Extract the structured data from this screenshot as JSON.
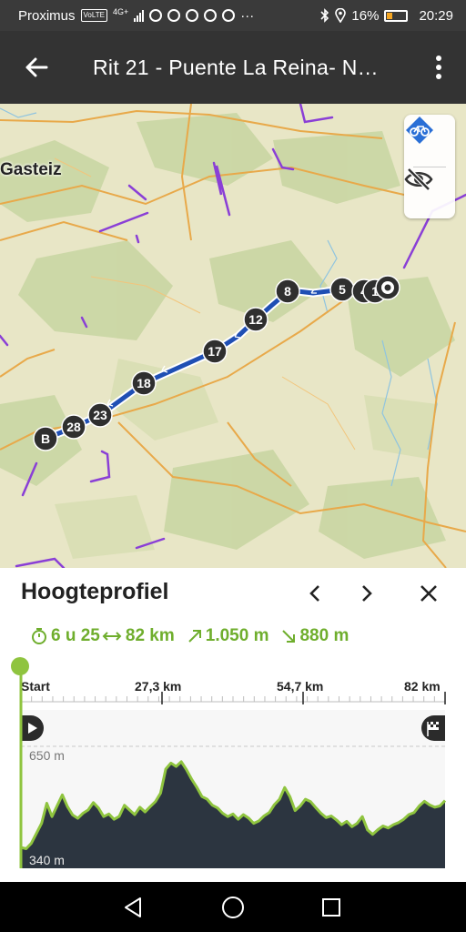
{
  "status_bar": {
    "carrier": "Proximus",
    "volte": "VoLTE",
    "network": "4G+",
    "more": "···",
    "battery": "16%",
    "time": "20:29"
  },
  "app_bar": {
    "title": "Rit 21 - Puente La Reina- N…"
  },
  "map": {
    "place_label": "Gasteiz",
    "waypoints": [
      "B",
      "28",
      "23",
      "18",
      "17",
      "12",
      "8",
      "5",
      "4",
      "1"
    ],
    "route_color": "#1f4fb4",
    "marker_color": "#2f2f2f"
  },
  "panel": {
    "title": "Hoogteprofiel",
    "stats": {
      "duration": "6 u 25",
      "distance": "82 km",
      "ascent": "1.050 m",
      "descent": "880 m"
    },
    "accent_color": "#6fae2d",
    "axis": {
      "start": "Start",
      "t1": "27,3 km",
      "t2": "54,7 km",
      "end": "82 km"
    },
    "elevation": {
      "max_label": "650 m",
      "min_label": "340 m"
    }
  },
  "chart_data": {
    "type": "area",
    "title": "Hoogteprofiel",
    "xlabel": "",
    "ylabel": "",
    "x_tick_labels": [
      "Start",
      "27,3 km",
      "54,7 km",
      "82 km"
    ],
    "y_tick_labels": [
      "650 m",
      "340 m"
    ],
    "xlim": [
      0,
      82
    ],
    "ylim": [
      340,
      650
    ],
    "grid": true,
    "x": [
      0,
      1,
      2,
      4,
      5,
      6,
      8,
      9,
      10,
      11,
      12,
      13,
      14,
      15,
      16,
      17,
      18,
      19,
      20,
      21,
      22,
      23,
      24,
      25,
      26,
      27,
      28,
      29,
      30,
      31,
      32,
      33,
      34,
      35,
      36,
      37,
      38,
      39,
      40,
      41,
      42,
      43,
      44,
      45,
      46,
      47,
      48,
      49,
      50,
      51,
      52,
      53,
      54,
      55,
      56,
      57,
      58,
      59,
      60,
      61,
      62,
      63,
      64,
      65,
      66,
      67,
      68,
      69,
      70,
      71,
      72,
      73,
      74,
      75,
      76,
      77,
      78,
      79,
      80,
      81,
      82
    ],
    "values": [
      348,
      344,
      360,
      420,
      480,
      440,
      505,
      470,
      445,
      435,
      450,
      460,
      482,
      466,
      440,
      448,
      432,
      441,
      474,
      460,
      446,
      468,
      454,
      470,
      485,
      510,
      582,
      600,
      590,
      604,
      580,
      552,
      528,
      500,
      492,
      474,
      466,
      450,
      440,
      448,
      432,
      446,
      436,
      420,
      427,
      442,
      452,
      476,
      492,
      527,
      500,
      458,
      472,
      492,
      485,
      467,
      450,
      437,
      442,
      430,
      416,
      426,
      410,
      420,
      440,
      400,
      387,
      401,
      412,
      406,
      416,
      422,
      432,
      446,
      452,
      472,
      486,
      475,
      468,
      472,
      488
    ]
  },
  "nav_bar": {
    "back": "back",
    "home": "home",
    "recents": "recents"
  }
}
